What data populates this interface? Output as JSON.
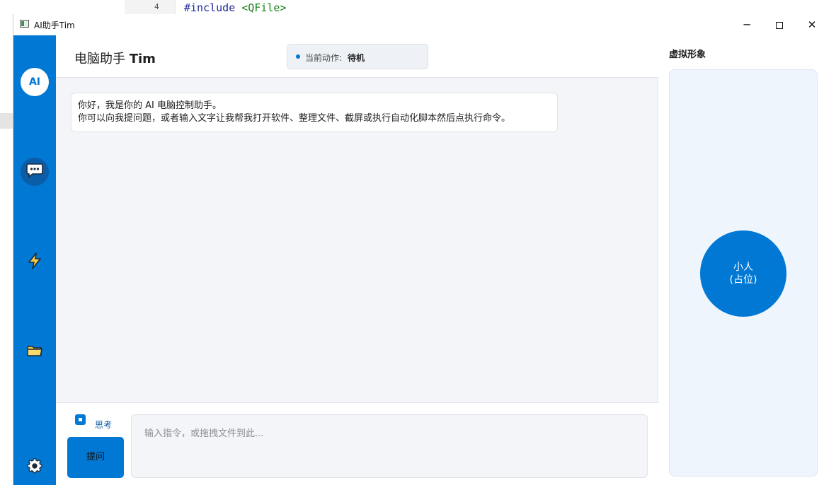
{
  "background_editor": {
    "line_number": "4",
    "code_keyword": "#include",
    "code_target": "<QFile>"
  },
  "window": {
    "title": "AI助手Tim",
    "buttons": {
      "minimize": "─",
      "close": "✕"
    }
  },
  "sidebar": {
    "avatar_text": "AI",
    "items": [
      {
        "name": "chat",
        "icon": "chat-bubble-icon",
        "active": true
      },
      {
        "name": "quick-actions",
        "icon": "lightning-icon",
        "active": false
      },
      {
        "name": "files",
        "icon": "folder-icon",
        "active": false
      },
      {
        "name": "settings",
        "icon": "gear-icon",
        "active": false
      }
    ]
  },
  "header": {
    "brand_prefix": "电脑助手",
    "brand_name": "Tim",
    "status_label": "当前动作:",
    "status_value": "待机"
  },
  "messages": [
    {
      "line1": "你好，我是你的 AI 电脑控制助手。",
      "line2": "你可以向我提问题，或者输入文字让我帮我打开软件、整理文件、截屏或执行自动化脚本然后点执行命令。"
    }
  ],
  "composer": {
    "think_label": "思考",
    "think_checked": true,
    "ask_button": "提问",
    "input_placeholder": "输入指令，或拖拽文件到此..."
  },
  "avatar_panel": {
    "title": "虚拟形象",
    "figure_line1": "小人",
    "figure_line2": "(占位)"
  },
  "colors": {
    "accent": "#0078d4",
    "main_bg": "#f3f5f8",
    "panel_stage_bg": "#eef5fd"
  }
}
